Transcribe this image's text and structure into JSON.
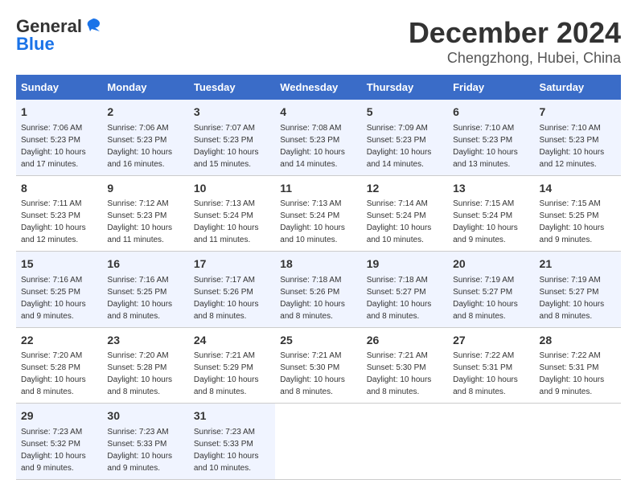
{
  "header": {
    "logo_line1": "General",
    "logo_line2": "Blue",
    "month": "December 2024",
    "location": "Chengzhong, Hubei, China"
  },
  "weekdays": [
    "Sunday",
    "Monday",
    "Tuesday",
    "Wednesday",
    "Thursday",
    "Friday",
    "Saturday"
  ],
  "weeks": [
    [
      {
        "day": "1",
        "info": "Sunrise: 7:06 AM\nSunset: 5:23 PM\nDaylight: 10 hours\nand 17 minutes."
      },
      {
        "day": "2",
        "info": "Sunrise: 7:06 AM\nSunset: 5:23 PM\nDaylight: 10 hours\nand 16 minutes."
      },
      {
        "day": "3",
        "info": "Sunrise: 7:07 AM\nSunset: 5:23 PM\nDaylight: 10 hours\nand 15 minutes."
      },
      {
        "day": "4",
        "info": "Sunrise: 7:08 AM\nSunset: 5:23 PM\nDaylight: 10 hours\nand 14 minutes."
      },
      {
        "day": "5",
        "info": "Sunrise: 7:09 AM\nSunset: 5:23 PM\nDaylight: 10 hours\nand 14 minutes."
      },
      {
        "day": "6",
        "info": "Sunrise: 7:10 AM\nSunset: 5:23 PM\nDaylight: 10 hours\nand 13 minutes."
      },
      {
        "day": "7",
        "info": "Sunrise: 7:10 AM\nSunset: 5:23 PM\nDaylight: 10 hours\nand 12 minutes."
      }
    ],
    [
      {
        "day": "8",
        "info": "Sunrise: 7:11 AM\nSunset: 5:23 PM\nDaylight: 10 hours\nand 12 minutes."
      },
      {
        "day": "9",
        "info": "Sunrise: 7:12 AM\nSunset: 5:23 PM\nDaylight: 10 hours\nand 11 minutes."
      },
      {
        "day": "10",
        "info": "Sunrise: 7:13 AM\nSunset: 5:24 PM\nDaylight: 10 hours\nand 11 minutes."
      },
      {
        "day": "11",
        "info": "Sunrise: 7:13 AM\nSunset: 5:24 PM\nDaylight: 10 hours\nand 10 minutes."
      },
      {
        "day": "12",
        "info": "Sunrise: 7:14 AM\nSunset: 5:24 PM\nDaylight: 10 hours\nand 10 minutes."
      },
      {
        "day": "13",
        "info": "Sunrise: 7:15 AM\nSunset: 5:24 PM\nDaylight: 10 hours\nand 9 minutes."
      },
      {
        "day": "14",
        "info": "Sunrise: 7:15 AM\nSunset: 5:25 PM\nDaylight: 10 hours\nand 9 minutes."
      }
    ],
    [
      {
        "day": "15",
        "info": "Sunrise: 7:16 AM\nSunset: 5:25 PM\nDaylight: 10 hours\nand 9 minutes."
      },
      {
        "day": "16",
        "info": "Sunrise: 7:16 AM\nSunset: 5:25 PM\nDaylight: 10 hours\nand 8 minutes."
      },
      {
        "day": "17",
        "info": "Sunrise: 7:17 AM\nSunset: 5:26 PM\nDaylight: 10 hours\nand 8 minutes."
      },
      {
        "day": "18",
        "info": "Sunrise: 7:18 AM\nSunset: 5:26 PM\nDaylight: 10 hours\nand 8 minutes."
      },
      {
        "day": "19",
        "info": "Sunrise: 7:18 AM\nSunset: 5:27 PM\nDaylight: 10 hours\nand 8 minutes."
      },
      {
        "day": "20",
        "info": "Sunrise: 7:19 AM\nSunset: 5:27 PM\nDaylight: 10 hours\nand 8 minutes."
      },
      {
        "day": "21",
        "info": "Sunrise: 7:19 AM\nSunset: 5:27 PM\nDaylight: 10 hours\nand 8 minutes."
      }
    ],
    [
      {
        "day": "22",
        "info": "Sunrise: 7:20 AM\nSunset: 5:28 PM\nDaylight: 10 hours\nand 8 minutes."
      },
      {
        "day": "23",
        "info": "Sunrise: 7:20 AM\nSunset: 5:28 PM\nDaylight: 10 hours\nand 8 minutes."
      },
      {
        "day": "24",
        "info": "Sunrise: 7:21 AM\nSunset: 5:29 PM\nDaylight: 10 hours\nand 8 minutes."
      },
      {
        "day": "25",
        "info": "Sunrise: 7:21 AM\nSunset: 5:30 PM\nDaylight: 10 hours\nand 8 minutes."
      },
      {
        "day": "26",
        "info": "Sunrise: 7:21 AM\nSunset: 5:30 PM\nDaylight: 10 hours\nand 8 minutes."
      },
      {
        "day": "27",
        "info": "Sunrise: 7:22 AM\nSunset: 5:31 PM\nDaylight: 10 hours\nand 8 minutes."
      },
      {
        "day": "28",
        "info": "Sunrise: 7:22 AM\nSunset: 5:31 PM\nDaylight: 10 hours\nand 9 minutes."
      }
    ],
    [
      {
        "day": "29",
        "info": "Sunrise: 7:23 AM\nSunset: 5:32 PM\nDaylight: 10 hours\nand 9 minutes."
      },
      {
        "day": "30",
        "info": "Sunrise: 7:23 AM\nSunset: 5:33 PM\nDaylight: 10 hours\nand 9 minutes."
      },
      {
        "day": "31",
        "info": "Sunrise: 7:23 AM\nSunset: 5:33 PM\nDaylight: 10 hours\nand 10 minutes."
      },
      null,
      null,
      null,
      null
    ]
  ]
}
